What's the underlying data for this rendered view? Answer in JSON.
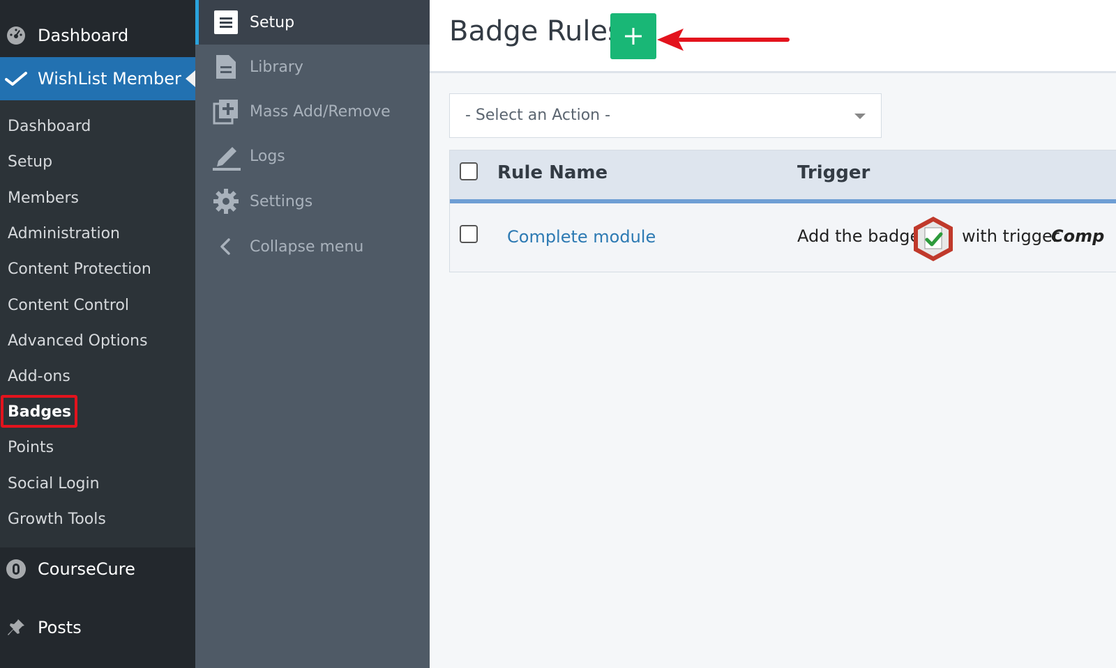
{
  "admin_menu": {
    "dashboard_label": "Dashboard",
    "wishlist_label": "WishList Member",
    "submenu": [
      "Dashboard",
      "Setup",
      "Members",
      "Administration",
      "Content Protection",
      "Content Control",
      "Advanced Options",
      "Add-ons",
      "Badges",
      "Points",
      "Social Login",
      "Growth Tools"
    ],
    "active_submenu": "Badges",
    "coursecure_label": "CourseCure",
    "posts_label": "Posts"
  },
  "wl_menu": {
    "items": [
      {
        "label": "Setup",
        "icon": "hamburger-icon"
      },
      {
        "label": "Library",
        "icon": "document-icon"
      },
      {
        "label": "Mass Add/Remove",
        "icon": "add-stack-icon"
      },
      {
        "label": "Logs",
        "icon": "pencil-icon"
      },
      {
        "label": "Settings",
        "icon": "gear-icon"
      },
      {
        "label": "Collapse menu",
        "icon": "chevron-left-icon"
      }
    ]
  },
  "main": {
    "title": "Badge Rules",
    "add_button_label": "+",
    "action_select": "- Select an Action -",
    "table": {
      "headers": [
        "Rule Name",
        "Trigger"
      ],
      "rows": [
        {
          "rule_name": "Complete module",
          "trigger_prefix": "Add the badge",
          "trigger_mid": "with trigger",
          "trigger_value": "Comp"
        }
      ]
    }
  },
  "colors": {
    "sidebar_bg": "#23282d",
    "active_blue": "#2271b1",
    "secondary_menu_bg": "#4f5a66",
    "add_button_green": "#19b776",
    "highlight_red": "#e3131d",
    "link_blue": "#2d7ab3"
  }
}
